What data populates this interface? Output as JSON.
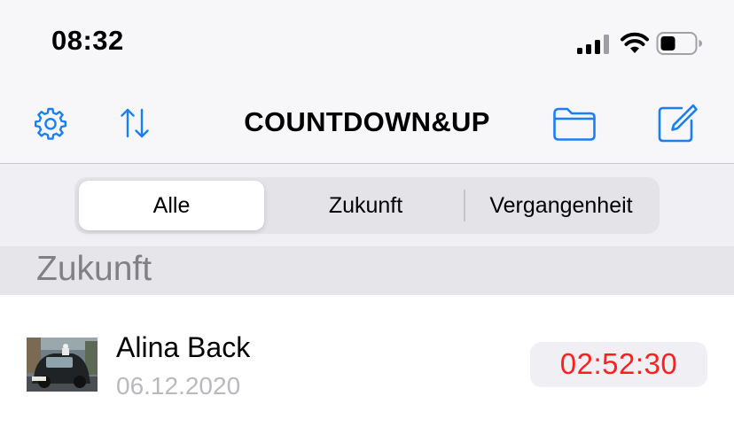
{
  "status_bar": {
    "time": "08:32"
  },
  "nav": {
    "title": "COUNTDOWN&UP",
    "icons": [
      "gear-icon",
      "sort-arrows-icon",
      "folder-icon",
      "compose-icon"
    ],
    "accent_color": "#1a7ff5"
  },
  "segments": {
    "items": [
      "Alle",
      "Zukunft",
      "Vergangenheit"
    ],
    "selected": "Alle"
  },
  "section": {
    "title": "Zukunft"
  },
  "entries": [
    {
      "name": "Alina Back",
      "date": "06.12.2020",
      "countdown": "02:52:30",
      "countdown_color": "#ff1f1f"
    }
  ]
}
